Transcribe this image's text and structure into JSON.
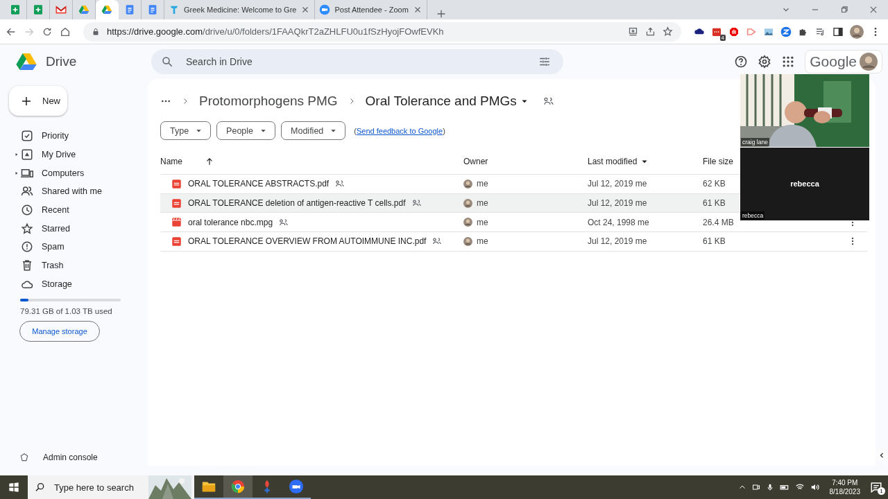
{
  "browser": {
    "tabs": [
      {
        "kind": "sheets",
        "selected": false
      },
      {
        "kind": "sheets",
        "selected": false
      },
      {
        "kind": "gmail",
        "selected": false
      },
      {
        "kind": "drive",
        "selected": false
      },
      {
        "kind": "drive",
        "selected": true
      },
      {
        "kind": "docs",
        "selected": false
      },
      {
        "kind": "docs",
        "selected": false
      },
      {
        "kind": "site",
        "title": "Greek Medicine: Welcome to Gre",
        "selected": false
      },
      {
        "kind": "zoom",
        "title": "Post Attendee - Zoom",
        "selected": false
      }
    ],
    "url_host": "https://drive.google.com",
    "url_path": "/drive/u/0/folders/1FAAQkrT2aZHLFU0u1fSzHyojFOwfEVKh",
    "extension_badge": "4"
  },
  "drive": {
    "app_name": "Drive",
    "new_button": "New",
    "search": {
      "placeholder": "Search in Drive"
    },
    "brand": "Google",
    "nav": [
      {
        "kind": "priority",
        "label": "Priority",
        "expandable": false
      },
      {
        "kind": "my_drive",
        "label": "My Drive",
        "expandable": true
      },
      {
        "kind": "computers",
        "label": "Computers",
        "expandable": true
      },
      {
        "kind": "shared",
        "label": "Shared with me",
        "expandable": false
      },
      {
        "kind": "recent",
        "label": "Recent",
        "expandable": false
      },
      {
        "kind": "starred",
        "label": "Starred",
        "expandable": false
      },
      {
        "kind": "spam",
        "label": "Spam",
        "expandable": false
      },
      {
        "kind": "trash",
        "label": "Trash",
        "expandable": false
      },
      {
        "kind": "storage",
        "label": "Storage",
        "expandable": false
      }
    ],
    "storage": {
      "level": 0.08,
      "usage": "79.31 GB of 1.03 TB used",
      "button": "Manage storage"
    },
    "admin": "Admin console",
    "breadcrumb": {
      "parent": "Protomorphogens PMG",
      "current": "Oral Tolerance and PMGs"
    },
    "filters": [
      "Type",
      "People",
      "Modified"
    ],
    "feedback": {
      "open": "(",
      "link": "Send feedback to Google",
      "close": ")"
    },
    "columns": [
      {
        "label": "Name",
        "kind": "sort_arrow"
      },
      {
        "label": "Owner",
        "kind": "plain"
      },
      {
        "label": "Last modified",
        "kind": "sort_menu"
      },
      {
        "label": "File size",
        "kind": "plain"
      }
    ],
    "rows": [
      {
        "kind": "pdf",
        "name": "ORAL TOLERANCE ABSTRACTS.pdf",
        "owner": "me",
        "modified": "Jul 12, 2019 me",
        "size": "62 KB",
        "hovered": false,
        "menu_shown": false
      },
      {
        "kind": "pdf",
        "name": "ORAL TOLERANCE deletion of antigen-reactive T cells.pdf",
        "owner": "me",
        "modified": "Jul 12, 2019 me",
        "size": "61 KB",
        "hovered": true,
        "menu_shown": false
      },
      {
        "kind": "video",
        "name": "oral tolerance nbc.mpg",
        "owner": "me",
        "modified": "Oct 24, 1998 me",
        "size": "26.4 MB",
        "hovered": false,
        "menu_shown": true
      },
      {
        "kind": "pdf",
        "name": "ORAL TOLERANCE OVERVIEW FROM AUTOIMMUNE INC.pdf",
        "owner": "me",
        "modified": "Jul 12, 2019 me",
        "size": "61 KB",
        "hovered": false,
        "menu_shown": true
      }
    ]
  },
  "zoom": {
    "tiles": [
      {
        "kind": "video",
        "name": "craig lane"
      },
      {
        "kind": "off",
        "name": "rebecca",
        "center_name": "rebecca"
      }
    ]
  },
  "taskbar": {
    "search_placeholder": "Type here to search",
    "time": "7:40 PM",
    "date": "8/18/2023",
    "notifications": "1",
    "apps": [
      {
        "kind": "explorer",
        "selected": false
      },
      {
        "kind": "chrome",
        "selected": true
      },
      {
        "kind": "tool",
        "selected": false
      },
      {
        "kind": "zoom",
        "selected": false
      }
    ]
  }
}
